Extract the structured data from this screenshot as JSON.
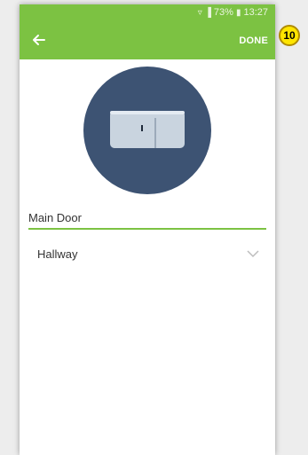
{
  "status_bar": {
    "battery": "73%",
    "time": "13:27"
  },
  "toolbar": {
    "done_label": "DONE"
  },
  "annotation": {
    "step_number": "10"
  },
  "device": {
    "icon": "door-sensor-icon",
    "name_value": "Main Door",
    "room_value": "Hallway"
  },
  "colors": {
    "accent": "#7cc242",
    "avatar_bg": "#3d5373",
    "device_body": "#c9d4df"
  }
}
